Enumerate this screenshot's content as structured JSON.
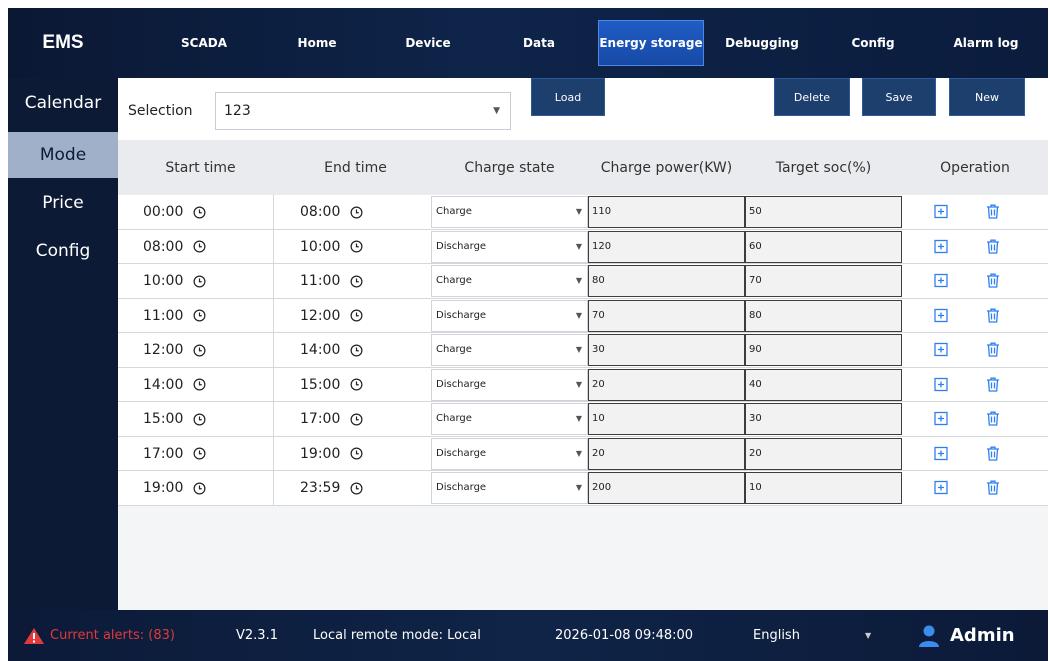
{
  "app": {
    "logo": "EMS"
  },
  "nav": {
    "items": [
      {
        "label": "SCADA"
      },
      {
        "label": "Home"
      },
      {
        "label": "Device"
      },
      {
        "label": "Data"
      },
      {
        "label": "Energy storage",
        "active": true
      },
      {
        "label": "Debugging"
      },
      {
        "label": "Config"
      },
      {
        "label": "Alarm log"
      }
    ]
  },
  "sidebar": {
    "items": [
      {
        "label": "Calendar"
      },
      {
        "label": "Mode",
        "active": true
      },
      {
        "label": "Price"
      },
      {
        "label": "Config"
      }
    ]
  },
  "toolbar": {
    "selection_label": "Selection",
    "selection_value": "123",
    "load_label": "Load",
    "delete_label": "Delete",
    "save_label": "Save",
    "new_label": "New"
  },
  "table": {
    "headers": [
      "Start time",
      "End time",
      "Charge state",
      "Charge power(KW)",
      "Target soc(%)",
      "Operation"
    ],
    "rows": [
      {
        "start": "00:00",
        "end": "08:00",
        "state": "Charge",
        "power": "110",
        "soc": "50"
      },
      {
        "start": "08:00",
        "end": "10:00",
        "state": "Discharge",
        "power": "120",
        "soc": "60"
      },
      {
        "start": "10:00",
        "end": "11:00",
        "state": "Charge",
        "power": "80",
        "soc": "70"
      },
      {
        "start": "11:00",
        "end": "12:00",
        "state": "Discharge",
        "power": "70",
        "soc": "80"
      },
      {
        "start": "12:00",
        "end": "14:00",
        "state": "Charge",
        "power": "30",
        "soc": "90"
      },
      {
        "start": "14:00",
        "end": "15:00",
        "state": "Discharge",
        "power": "20",
        "soc": "40"
      },
      {
        "start": "15:00",
        "end": "17:00",
        "state": "Charge",
        "power": "10",
        "soc": "30"
      },
      {
        "start": "17:00",
        "end": "19:00",
        "state": "Discharge",
        "power": "20",
        "soc": "20"
      },
      {
        "start": "19:00",
        "end": "23:59",
        "state": "Discharge",
        "power": "200",
        "soc": "10"
      }
    ]
  },
  "status": {
    "alerts": "Current alerts: (83)",
    "version": "V2.3.1",
    "mode": "Local remote mode: Local",
    "datetime": "2026-01-08 09:48:00",
    "language": "English",
    "user": "Admin"
  },
  "colors": {
    "nav_bg": "#0d1a36",
    "active_tab": "#1f5cc4",
    "button": "#1d3f6e",
    "icon_blue": "#2f7ff0",
    "alert_red": "#e03a3a"
  },
  "icons": {
    "clock": "clock-icon",
    "add": "add-row-icon",
    "delete": "delete-row-icon",
    "alert": "alert-icon",
    "user": "user-icon"
  }
}
